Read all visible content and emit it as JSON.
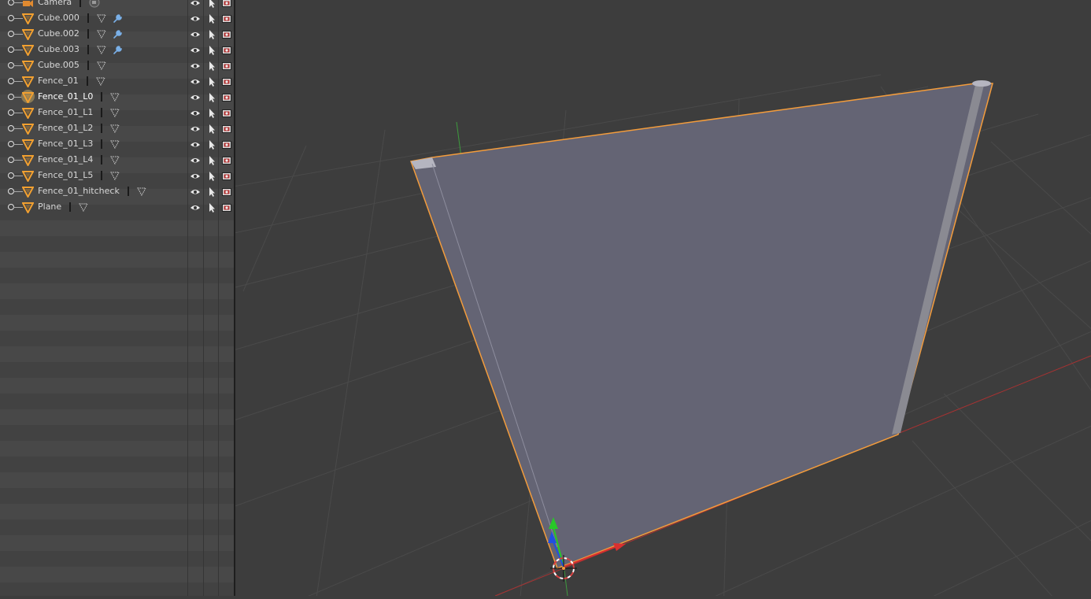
{
  "outliner": {
    "items": [
      {
        "name": "Camera",
        "type": "camera",
        "active": false,
        "modifier": false
      },
      {
        "name": "Cube.000",
        "type": "mesh",
        "active": false,
        "modifier": true
      },
      {
        "name": "Cube.002",
        "type": "mesh",
        "active": false,
        "modifier": true
      },
      {
        "name": "Cube.003",
        "type": "mesh",
        "active": false,
        "modifier": true
      },
      {
        "name": "Cube.005",
        "type": "mesh",
        "active": false,
        "modifier": false
      },
      {
        "name": "Fence_01",
        "type": "mesh",
        "active": false,
        "modifier": false
      },
      {
        "name": "Fence_01_L0",
        "type": "mesh",
        "active": true,
        "modifier": false
      },
      {
        "name": "Fence_01_L1",
        "type": "mesh",
        "active": false,
        "modifier": false
      },
      {
        "name": "Fence_01_L2",
        "type": "mesh",
        "active": false,
        "modifier": false
      },
      {
        "name": "Fence_01_L3",
        "type": "mesh",
        "active": false,
        "modifier": false
      },
      {
        "name": "Fence_01_L4",
        "type": "mesh",
        "active": false,
        "modifier": false
      },
      {
        "name": "Fence_01_L5",
        "type": "mesh",
        "active": false,
        "modifier": false
      },
      {
        "name": "Fence_01_hitcheck",
        "type": "mesh",
        "active": false,
        "modifier": false
      },
      {
        "name": "Plane",
        "type": "mesh",
        "active": false,
        "modifier": false
      }
    ],
    "restrict_icons": [
      "eye-icon",
      "cursor-icon",
      "render-icon"
    ]
  },
  "viewport": {
    "background": "#3d3d3d",
    "grid_color": "#4a4a4a",
    "object_color": "#646474",
    "selection_outline": "#f39c3c",
    "axis_x_color": "#a83232",
    "axis_y_color": "#3e9a3e",
    "gizmo_colors": {
      "x": "#d83030",
      "y": "#28c828",
      "z": "#2050e0"
    }
  }
}
